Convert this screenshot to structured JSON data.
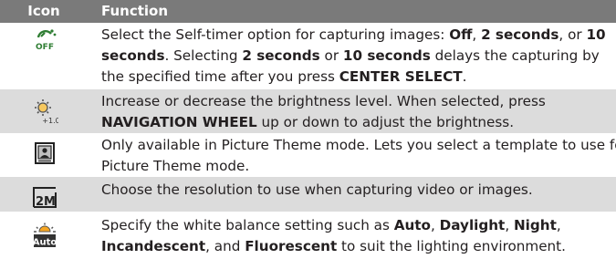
{
  "header": {
    "icon_col": "Icon",
    "function_col": "Function"
  },
  "rows": [
    {
      "icon": "self-timer-off-icon",
      "icon_text": "OFF",
      "lines": [
        [
          {
            "t": "Select the Self-timer option for capturing images: ",
            "b": false
          },
          {
            "t": "Off",
            "b": true
          },
          {
            "t": ", ",
            "b": false
          },
          {
            "t": "2 seconds",
            "b": true
          },
          {
            "t": ", or ",
            "b": false
          },
          {
            "t": "10",
            "b": true
          }
        ],
        [
          {
            "t": "seconds",
            "b": true
          },
          {
            "t": ". Selecting ",
            "b": false
          },
          {
            "t": "2 seconds",
            "b": true
          },
          {
            "t": " or ",
            "b": false
          },
          {
            "t": "10 seconds",
            "b": true
          },
          {
            "t": " delays the capturing by",
            "b": false
          }
        ],
        [
          {
            "t": "the specified time after you press ",
            "b": false
          },
          {
            "t": "CENTER SELECT",
            "b": true
          },
          {
            "t": ".",
            "b": false
          }
        ]
      ]
    },
    {
      "icon": "brightness-icon",
      "icon_text": "+1.0",
      "lines": [
        [
          {
            "t": "Increase or decrease the brightness level. When selected, press",
            "b": false
          }
        ],
        [
          {
            "t": "NAVIGATION WHEEL",
            "b": true
          },
          {
            "t": " up or down to adjust the brightness.",
            "b": false
          }
        ]
      ]
    },
    {
      "icon": "picture-theme-template-icon",
      "icon_text": "",
      "lines": [
        [
          {
            "t": "Only available in Picture Theme mode. Lets you select a template to use for",
            "b": false
          }
        ],
        [
          {
            "t": "Picture Theme mode.",
            "b": false
          }
        ]
      ]
    },
    {
      "icon": "resolution-2m-icon",
      "icon_text": "2M",
      "lines": [
        [
          {
            "t": "Choose the resolution to use when capturing video or images.",
            "b": false
          }
        ]
      ]
    },
    {
      "icon": "white-balance-auto-icon",
      "icon_text": "Auto",
      "lines": [
        [
          {
            "t": "Specify the white balance setting such as ",
            "b": false
          },
          {
            "t": "Auto",
            "b": true
          },
          {
            "t": ", ",
            "b": false
          },
          {
            "t": "Daylight",
            "b": true
          },
          {
            "t": ", ",
            "b": false
          },
          {
            "t": "Night",
            "b": true
          },
          {
            "t": ",",
            "b": false
          }
        ],
        [
          {
            "t": "Incandescent",
            "b": true
          },
          {
            "t": ", and ",
            "b": false
          },
          {
            "t": "Fluorescent",
            "b": true
          },
          {
            "t": " to suit the lighting environment.",
            "b": false
          }
        ]
      ]
    }
  ],
  "colors": {
    "header_bg": "#7a7a7a",
    "shade_bg": "#dcdcdc",
    "text": "#231f20",
    "icon_green": "#2e7d32"
  }
}
